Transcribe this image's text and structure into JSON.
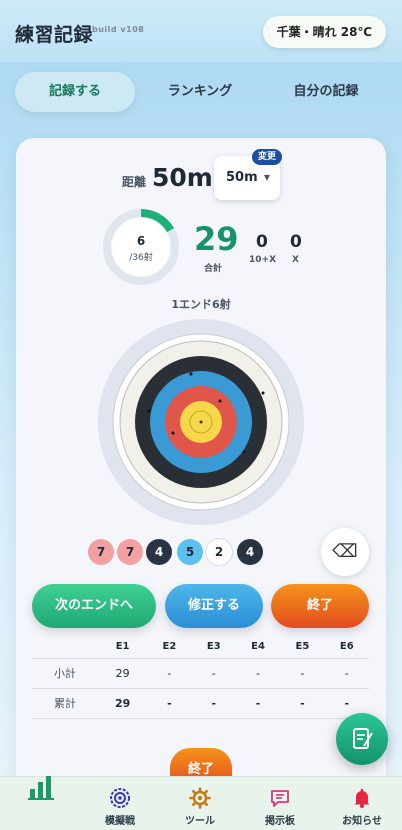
{
  "header": {
    "title": "練習記録",
    "build": "build v108",
    "weather": "千葉・晴れ 28℃"
  },
  "tabs": [
    {
      "label": "記録する",
      "active": true
    },
    {
      "label": "ランキング",
      "active": false
    },
    {
      "label": "自分の記録",
      "active": false
    }
  ],
  "distance": {
    "label": "距離",
    "value": "50m",
    "selected": "50m",
    "change_badge": "変更"
  },
  "progress": {
    "shot_count": "6",
    "shot_total": "/36射",
    "fraction": 0.1667
  },
  "stats": {
    "total": "29",
    "total_label": "合計",
    "tens": "0",
    "tens_label": "10+X",
    "x": "0",
    "x_label": "X"
  },
  "end_title": "1エンド6射",
  "shots": [
    {
      "value": "7",
      "color": "#f3a0a0"
    },
    {
      "value": "7",
      "color": "#f3a0a0"
    },
    {
      "value": "4",
      "color": "#2a3344"
    },
    {
      "value": "5",
      "color": "#5cc1ee"
    },
    {
      "value": "2",
      "color": "#ffffff"
    },
    {
      "value": "4",
      "color": "#2a3344"
    }
  ],
  "buttons": {
    "next_end": "次のエンドへ",
    "fix": "修正する",
    "finish": "終了",
    "finish_bottom": "終了"
  },
  "table": {
    "headers": [
      "",
      "E1",
      "E2",
      "E3",
      "E4",
      "E5",
      "E6"
    ],
    "subtotal": {
      "label": "小計",
      "values": [
        "29",
        "-",
        "-",
        "-",
        "-",
        "-"
      ]
    },
    "cumulative": {
      "label": "累計",
      "values": [
        "29",
        "-",
        "-",
        "-",
        "-",
        "-"
      ]
    }
  },
  "nav": [
    {
      "label": "",
      "icon": "bar-chart-icon"
    },
    {
      "label": "模擬戦",
      "icon": "target-badge-icon"
    },
    {
      "label": "ツール",
      "icon": "gear-icon"
    },
    {
      "label": "掲示板",
      "icon": "chat-icon"
    },
    {
      "label": "お知らせ",
      "icon": "bell-icon"
    }
  ],
  "colors": {
    "accent_green": "#16936a",
    "accent_blue": "#2a8ed6",
    "accent_orange": "#e24c1f",
    "badge_blue": "#1e4fa0"
  }
}
